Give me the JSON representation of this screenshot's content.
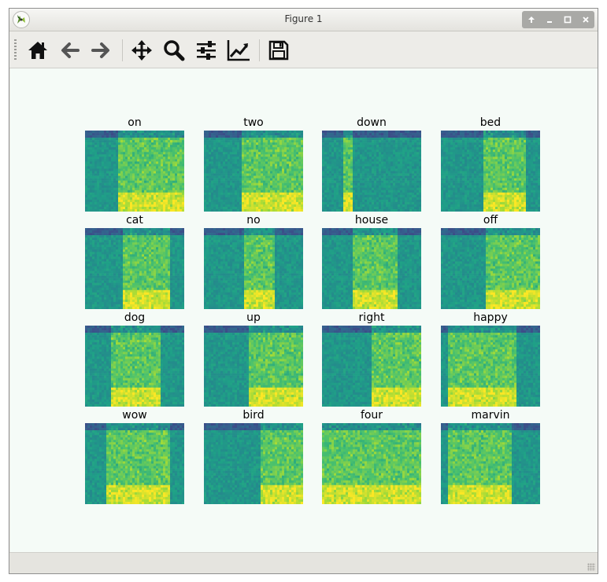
{
  "window": {
    "title": "Figure 1"
  },
  "toolbar": {
    "buttons": [
      {
        "name": "home-button",
        "icon": "home-icon"
      },
      {
        "name": "back-button",
        "icon": "arrow-left-icon"
      },
      {
        "name": "forward-button",
        "icon": "arrow-right-icon"
      },
      {
        "name": "pan-button",
        "icon": "move-icon"
      },
      {
        "name": "zoom-button",
        "icon": "zoom-icon"
      },
      {
        "name": "configure-subplots-button",
        "icon": "sliders-icon"
      },
      {
        "name": "edit-axes-button",
        "icon": "line-chart-icon"
      },
      {
        "name": "save-button",
        "icon": "save-icon"
      }
    ]
  },
  "figure": {
    "colormap": [
      "#46327e",
      "#365c8d",
      "#277f8e",
      "#1fa187",
      "#4ac16d",
      "#a0da39",
      "#fde725"
    ],
    "subplots": [
      {
        "label": "on"
      },
      {
        "label": "two"
      },
      {
        "label": "down"
      },
      {
        "label": "bed"
      },
      {
        "label": "cat"
      },
      {
        "label": "no"
      },
      {
        "label": "house"
      },
      {
        "label": "off"
      },
      {
        "label": "dog"
      },
      {
        "label": "up"
      },
      {
        "label": "right"
      },
      {
        "label": "happy"
      },
      {
        "label": "wow"
      },
      {
        "label": "bird"
      },
      {
        "label": "four"
      },
      {
        "label": "marvin"
      }
    ]
  }
}
